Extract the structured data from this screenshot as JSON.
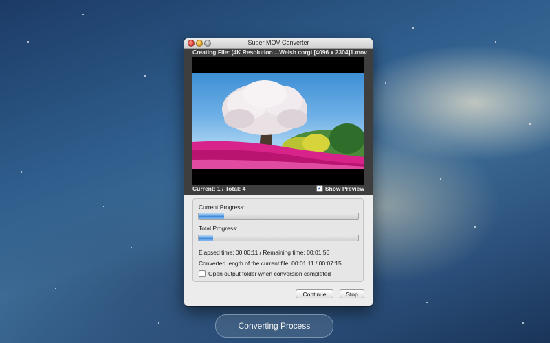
{
  "window": {
    "title": "Super MOV Converter",
    "creating_file": "Creating File: (4K Resolution ...Welsh corgi [4096 x 2304]1.mov",
    "current_total": "Current: 1 / Total: 4",
    "show_preview_label": "Show Preview",
    "show_preview_checked": true,
    "current_progress_label": "Current Progress:",
    "current_progress_fraction": 0.16,
    "total_progress_label": "Total Progress:",
    "total_progress_fraction": 0.09,
    "elapsed_text": "Elapsed time: 00:00:11 / Remaining time: 00:01:50",
    "converted_text": "Converted length of the current file: 00:01:11 / 00:07:15",
    "open_folder_label": "Open output folder when conversion completed",
    "open_folder_checked": false,
    "continue_label": "Continue",
    "stop_label": "Stop"
  },
  "caption": "Converting Process",
  "colors": {
    "accent_blue": "#3f86d8",
    "window_bg": "#ececec",
    "dark_panel": "#3e3e3e"
  }
}
